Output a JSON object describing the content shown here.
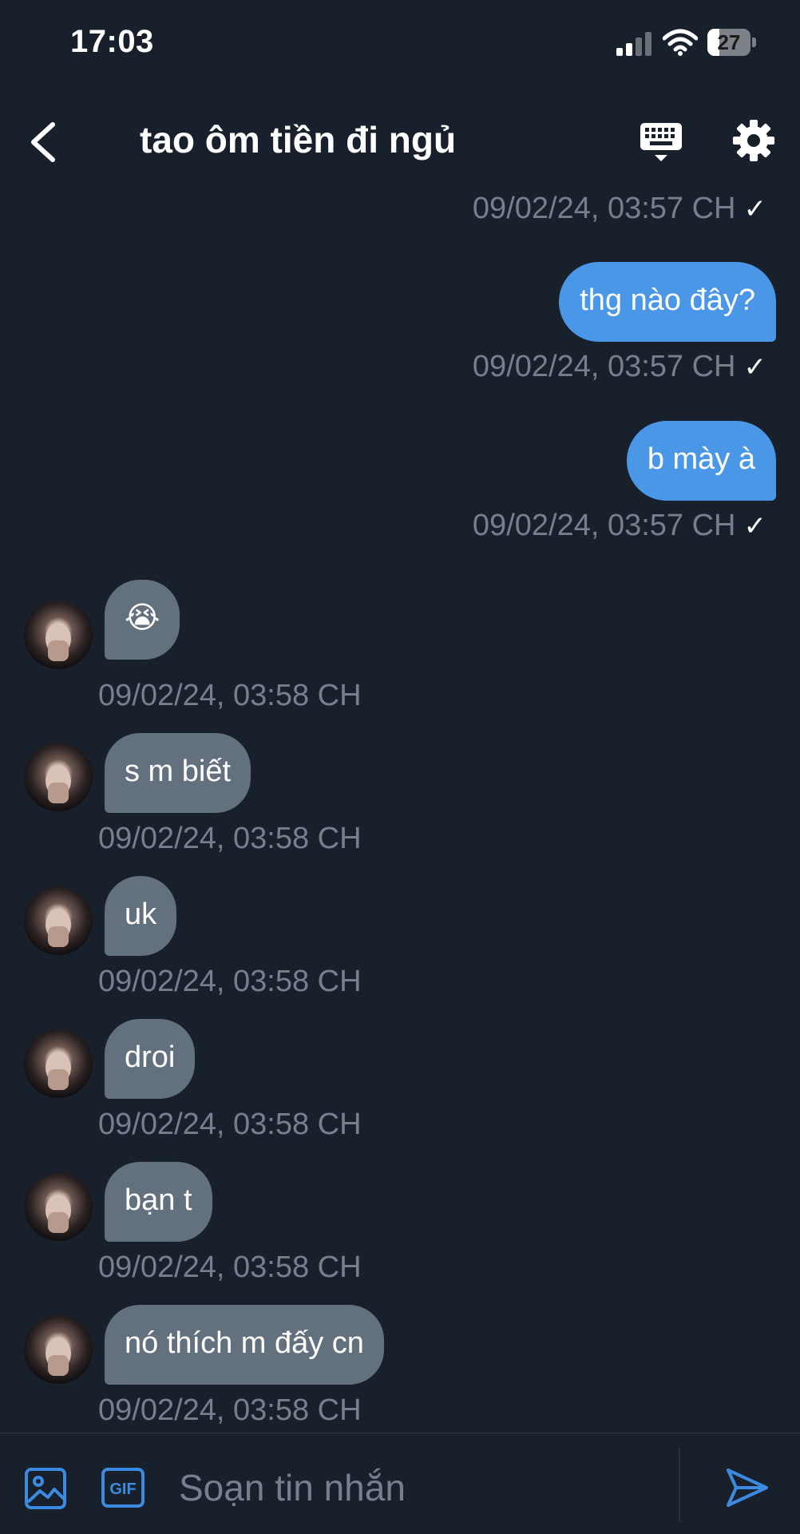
{
  "status_bar": {
    "time": "17:03",
    "battery": "27"
  },
  "header": {
    "title": "tao ôm tiền đi ngủ"
  },
  "messages": {
    "ts0": "09/02/24, 03:57 CH",
    "out1": {
      "text": "thg nào đây?",
      "time": "09/02/24, 03:57 CH"
    },
    "out2": {
      "text": "b mày à",
      "time": "09/02/24, 03:57 CH"
    },
    "in1": {
      "text": "😭",
      "time": "09/02/24, 03:58 CH"
    },
    "in2": {
      "text": "s m biết",
      "time": "09/02/24, 03:58 CH"
    },
    "in3": {
      "text": "uk",
      "time": "09/02/24, 03:58 CH"
    },
    "in4": {
      "text": "droi",
      "time": "09/02/24, 03:58 CH"
    },
    "in5": {
      "text": "bạn t",
      "time": "09/02/24, 03:58 CH"
    },
    "in6": {
      "text": "nó thích m đấy cn",
      "time": "09/02/24, 03:58 CH"
    },
    "read_check": "✓"
  },
  "composer": {
    "placeholder": "Soạn tin nhắn",
    "gif_label": "GIF"
  },
  "colors": {
    "background": "#18202b",
    "outgoing": "#4a97e8",
    "incoming": "#63707e",
    "accent": "#3d8be0",
    "muted": "#76808c"
  },
  "icons": [
    "back-icon",
    "keyboard-icon",
    "gear-icon",
    "image-icon",
    "gif-icon",
    "send-icon"
  ]
}
